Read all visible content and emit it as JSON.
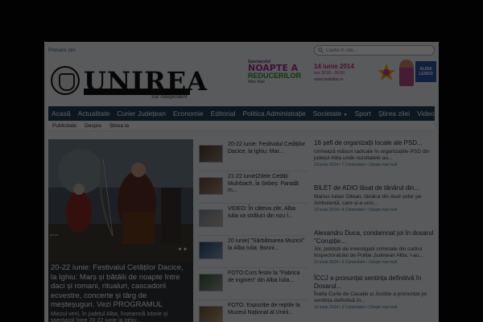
{
  "header": {
    "top_link": "Preluare știri",
    "search_placeholder": "Caută în site..."
  },
  "logo": {
    "name": "UNIREA",
    "tagline": "ziar independent"
  },
  "ad": {
    "small": "Spectacolul",
    "line1": "NOAPTE A",
    "line2": "REDUCERILOR",
    "mall": "Alba Mall",
    "date": "14 iunie 2014",
    "time": "ora 18:00 - 00:00",
    "url": "www.mallalba.ro",
    "label": "ALINA LESKO"
  },
  "nav": {
    "items": [
      "Acasă",
      "Actualitate",
      "Curier Județean",
      "Economie",
      "Editorial",
      "Politica Administrație",
      "Societate",
      "Sport",
      "Știrea zilei",
      "Video"
    ],
    "caret": "▼"
  },
  "subnav": {
    "items": [
      "Publicitate",
      "Despre",
      "Știrea ta"
    ]
  },
  "hero": {
    "credit": "presa",
    "arrows": "◄ ►",
    "title": "20-22 iunie: Festivalul Cetăților Dacice, la Ighiu: Marș și bătălii de noapte între daci și romani, ritualuri, cascadorii ecvestre, concerte și târg de meșteșuguri. Vezi PROGRAMUL",
    "text": "Miezul verii, în județul Alba, înseamnă istorie și spectacol între 20-22 iunie la Ighiu..."
  },
  "mid_items": [
    "20-22 iunie: Festivalul Cetăților Dacice, la Ighiu: Mar...",
    "21-22 iunie|Zilele Cetății Mulnbach, la Sebeș: Paradă m...",
    "VIDEO: În câteva zile, Alba Iulia va străluci din nou î...",
    "20 iunie| \"Sărbătoarea Muzicii\" la Alba Iulia: Bonni...",
    "FOTO:Curs festiv la \"Fabrica de ingineri\" din Alba Iulia...",
    "FOTO: Expoziție de reptile la Muzeul Național al Unirii..."
  ],
  "right_items": [
    {
      "title": "16 șefi de organizații locale ale PSD...",
      "text": "Urmează măsuri radicale în organizațiile PSD din județul Alba unde rezultatele au...",
      "date": "13 iunie 2014",
      "comments": "7 Comentarii",
      "more": "Citește mai mult"
    },
    {
      "title": "BILET de ADIO lăsat de tânărul din...",
      "text": "Marius Iulian Oltean, tânărul din Aiud șofer pe Ambulanță, care și-a ucis...",
      "date": "13 iunie 2014",
      "comments": "4 Comentarii",
      "more": "Citește mai mult"
    },
    {
      "title": "Alexandru Duca, condamnat joi în dosarul \"Corupție...",
      "text": "Joi, polițiștii de investigații criminale din cadrul Inspectoratului de Poliție Județean Alba, î-au...",
      "date": "13 iunie 2014",
      "comments": "6 Comentarii",
      "more": "Citește mai mult"
    },
    {
      "title": "ÎCCJ a pronunțat sentința definitivă în Dosarul...",
      "text": "Înalta Curte de Casație și Justiție a pronunțat joi sentința definitivă în...",
      "date": "12 iunie 2014",
      "comments": "2 Comentarii",
      "more": "Citește mai mult"
    }
  ],
  "colors": {
    "nav_bg": "#1f3f56",
    "page_bg": "#e9ecee",
    "outer_bg": "#070707",
    "overlay": "rgba(0,0,0,0.62)"
  }
}
